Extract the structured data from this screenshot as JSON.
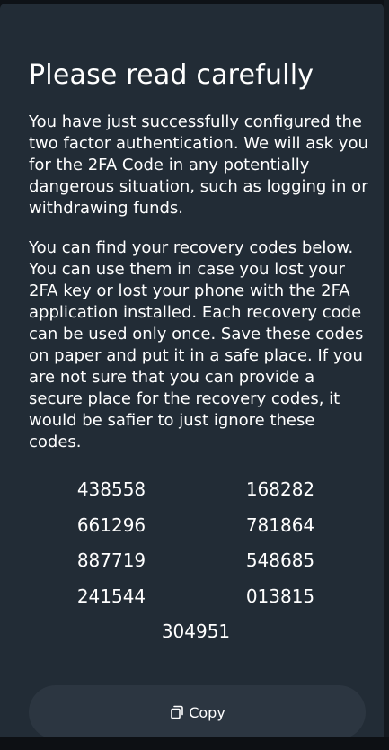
{
  "dialog": {
    "title": "Please read carefully",
    "paragraph_1": "You have just successfully configured the two factor authentication. We will ask you for the 2FA Code in any potentially dangerous situation, such as logging in or withdrawing funds.",
    "paragraph_2": "You can find your recovery codes below. You can use them in case you lost your 2FA key or lost your phone with the 2FA application installed. Each recovery code can be used only once. Save these codes on paper and put it in a safe place. If you are not sure that you can provide a secure place for the recovery codes, it would be safier to just ignore these codes."
  },
  "recovery_codes": [
    "438558",
    "168282",
    "661296",
    "781864",
    "887719",
    "548685",
    "241544",
    "013815",
    "304951"
  ],
  "copy_button": {
    "label": "Copy",
    "icon": "copy-icon"
  },
  "colors": {
    "modal_background": "#222c36",
    "button_background": "#2c3641",
    "text": "#ffffff"
  }
}
